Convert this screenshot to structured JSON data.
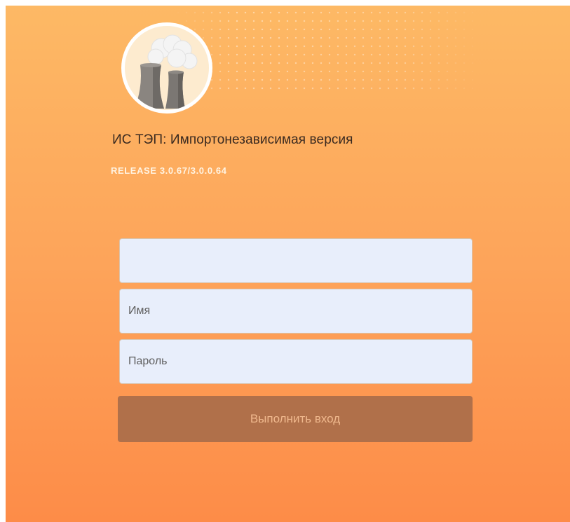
{
  "app": {
    "title": "ИС ТЭП: Импортонезависимая версия",
    "release": "RELEASE 3.0.67/3.0.0.64",
    "logo_icon": "power-plant-cooling-towers-icon"
  },
  "form": {
    "server_value": "",
    "name_placeholder": "Имя",
    "password_placeholder": "Пароль",
    "submit_label": "Выполнить вход"
  },
  "colors": {
    "background_top": "#fdb965",
    "background_bottom": "#fd8c48",
    "field_bg": "#e8eefb",
    "button_bg": "#b0704a",
    "button_text": "#f0b98e",
    "release_text": "#fff3e2"
  }
}
